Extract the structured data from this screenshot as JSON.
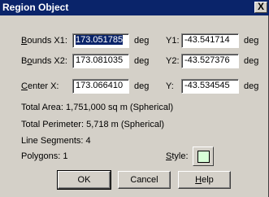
{
  "window": {
    "title": "Region Object",
    "close_label": "X"
  },
  "bounds": {
    "x1": {
      "label_key": "B",
      "label_rest": "ounds X1:",
      "value": "173.051785",
      "unit": "deg"
    },
    "y1": {
      "label": "Y1:",
      "value": "-43.541714",
      "unit": "deg"
    },
    "x2": {
      "label_pre": "B",
      "label_key": "o",
      "label_rest": "unds X2:",
      "value": "173.081035",
      "unit": "deg"
    },
    "y2": {
      "label": "Y2:",
      "value": "-43.527376",
      "unit": "deg"
    }
  },
  "center": {
    "x": {
      "label_key": "C",
      "label_rest": "enter X:",
      "value": "173.066410",
      "unit": "deg"
    },
    "y": {
      "label": "Y:",
      "value": "-43.534545",
      "unit": "deg"
    }
  },
  "info": {
    "total_area": "Total Area:  1,751,000 sq m (Spherical)",
    "total_perimeter": "Total Perimeter:  5,718 m (Spherical)",
    "line_segments": "Line Segments:  4",
    "polygons": "Polygons:  1"
  },
  "style": {
    "label_key": "S",
    "label_rest": "tyle:",
    "swatch_color": "#d8ffd8"
  },
  "buttons": {
    "ok": "OK",
    "cancel": "Cancel",
    "help_key": "H",
    "help_rest": "elp"
  }
}
